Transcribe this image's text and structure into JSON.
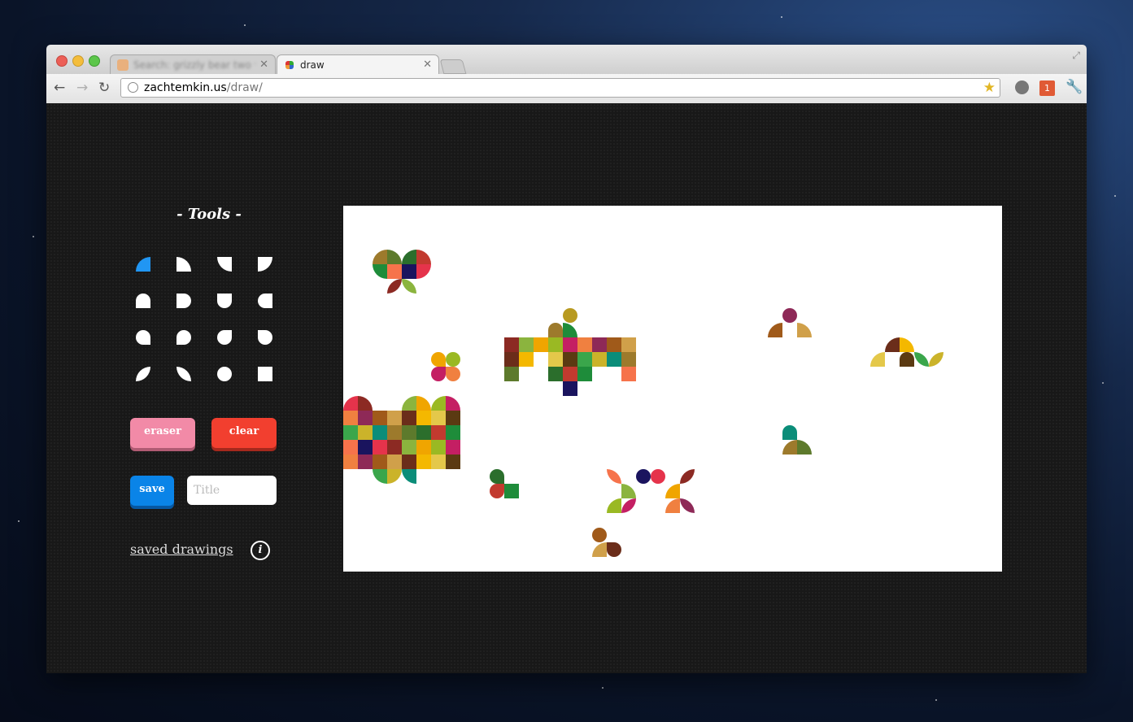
{
  "browser": {
    "tabs": [
      {
        "title": "Search: grizzly bear two wo...",
        "active": false
      },
      {
        "title": "draw",
        "active": true
      }
    ],
    "url_host": "zachtemkin.us",
    "url_path": "/draw/",
    "extension_badge": "1",
    "icons": [
      "back-icon",
      "forward-icon",
      "reload-icon",
      "globe-icon",
      "bookmark-star-icon",
      "download-icon",
      "extension-badge-icon",
      "wrench-icon"
    ]
  },
  "sidebar": {
    "tools_heading": "- Tools -",
    "selected_tool_index": 0,
    "selected_color": "#2196f3",
    "tool_shapes": [
      "quarter-tl",
      "quarter-tr",
      "quarter-bl",
      "quarter-br",
      "half-top",
      "half-right",
      "half-bottom",
      "half-left",
      "leaf-tl",
      "leaf-tr",
      "leaf-bl",
      "leaf-br",
      "leaf-diag-a",
      "leaf-diag-b",
      "circle",
      "square"
    ],
    "eraser_label": "eraser",
    "clear_label": "clear",
    "save_label": "save",
    "title_placeholder": "Title",
    "title_value": "",
    "saved_link": "saved drawings",
    "info_icon": "i"
  },
  "colors": {
    "accent_eraser": "#f28aa7",
    "accent_clear": "#f23f2f",
    "accent_save": "#0a84e8",
    "canvas_bg": "#ffffff"
  }
}
